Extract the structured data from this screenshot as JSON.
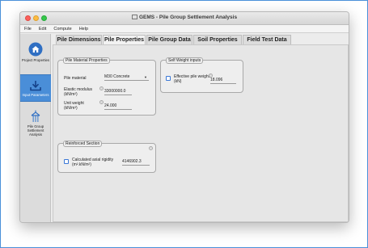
{
  "window": {
    "title": "GEMS - Pile Group Settlement Analysis"
  },
  "menu": [
    "File",
    "Edit",
    "Compute",
    "Help"
  ],
  "sidebar": {
    "items": [
      {
        "label": "Project Properties",
        "icon": "house-icon"
      },
      {
        "label": "Input Parameters",
        "icon": "download-icon"
      },
      {
        "label": "Pile Group Settlement Analysis",
        "icon": "pile-icon"
      }
    ]
  },
  "tabs": [
    "Pile Dimensions",
    "Pile Properties",
    "Pile Group Data",
    "Soil Properties",
    "Field Test Data"
  ],
  "pile_material": {
    "title": "Pile Material Properties",
    "material_label": "Pile material",
    "material_value": "M30 Concrete",
    "elastic_label_1": "Elastic modulus",
    "elastic_label_2": "(kN/m²)",
    "elastic_value": "33000000.0",
    "unit_label_1": "Unit weight",
    "unit_label_2": "(kN/m³)",
    "unit_value": "24.000"
  },
  "self_weight": {
    "title": "Self Weight inputs",
    "label_1": "Effective pile weight",
    "label_2": "(kN)",
    "value": "18.096"
  },
  "reinforced": {
    "title": "Reinforced Section",
    "label_1": "Calculated axial rigidity",
    "label_2": "(m².kN/m²)",
    "value": "4146902.3"
  },
  "colors": {
    "accent": "#4a8ed8",
    "checkbox": "#3b78d6"
  }
}
